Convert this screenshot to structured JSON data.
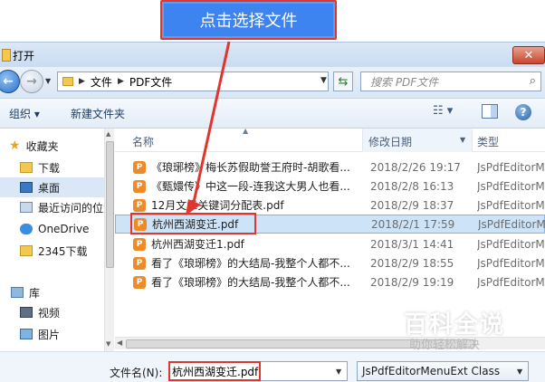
{
  "top_button": {
    "label": "点击选择文件",
    "border_color": "#e0362e",
    "fill_color": "#3d84f0"
  },
  "dialog": {
    "title": "打开",
    "close_icon": "close-x"
  },
  "address": {
    "crumbs": [
      "文件",
      "PDF文件"
    ],
    "search_placeholder": "搜索 PDF文件"
  },
  "toolbar": {
    "organize": "组织 ▾",
    "new_folder": "新建文件夹"
  },
  "sidebar": {
    "items": [
      {
        "label": "收藏夹",
        "icon": "star-icon"
      },
      {
        "label": "下载",
        "icon": "folder-icon"
      },
      {
        "label": "桌面",
        "icon": "desktop-icon"
      },
      {
        "label": "最近访问的位置",
        "icon": "recent-places-icon"
      },
      {
        "label": "OneDrive",
        "icon": "cloud-icon"
      },
      {
        "label": "2345下载",
        "icon": "folder-icon"
      },
      {
        "label": "库",
        "icon": "library-icon"
      },
      {
        "label": "视频",
        "icon": "video-icon"
      },
      {
        "label": "图片",
        "icon": "picture-icon"
      }
    ]
  },
  "file_list": {
    "columns": [
      "名称",
      "修改日期",
      "类型"
    ],
    "rows": [
      {
        "name": "《琅琊榜》梅长苏假助誉王府时-胡歌看...",
        "date": "2018/2/26 19:17",
        "type": "JsPdfEditorMenuExt Class"
      },
      {
        "name": "《甄嬛传》中这一段-连我这大男人也看...",
        "date": "2018/2/8 16:13",
        "type": "JsPdfEditorMenuExt Class"
      },
      {
        "name": "12月文章关键词分配表.pdf",
        "date": "2018/2/9 18:37",
        "type": "JsPdfEditorMenuExt Class"
      },
      {
        "name": "杭州西湖变迁.pdf",
        "date": "2018/2/1 17:59",
        "type": "JsPdfEditorMenuExt Class"
      },
      {
        "name": "杭州西湖变迁1.pdf",
        "date": "2018/3/1 14:41",
        "type": "JsPdfEditorMenuExt Class"
      },
      {
        "name": "看了《琅琊榜》的大结局-我整个人都不...",
        "date": "2018/2/9 18:55",
        "type": "JsPdfEditorMenuExt Class"
      },
      {
        "name": "看了《琅琊榜》的大结局-我整个人都不...",
        "date": "2018/2/9 19:19",
        "type": "JsPdfEditorMenuExt Class"
      }
    ],
    "selected_index": 3,
    "file_icon_letter": "P"
  },
  "bottom": {
    "filename_label": "文件名(N):",
    "filename_value": "杭州西湖变迁.pdf",
    "filter_value": "JsPdfEditorMenuExt Class"
  },
  "watermark": {
    "title": "百科全说",
    "subtitle": "助你轻松解决"
  },
  "help_glyph": "?"
}
